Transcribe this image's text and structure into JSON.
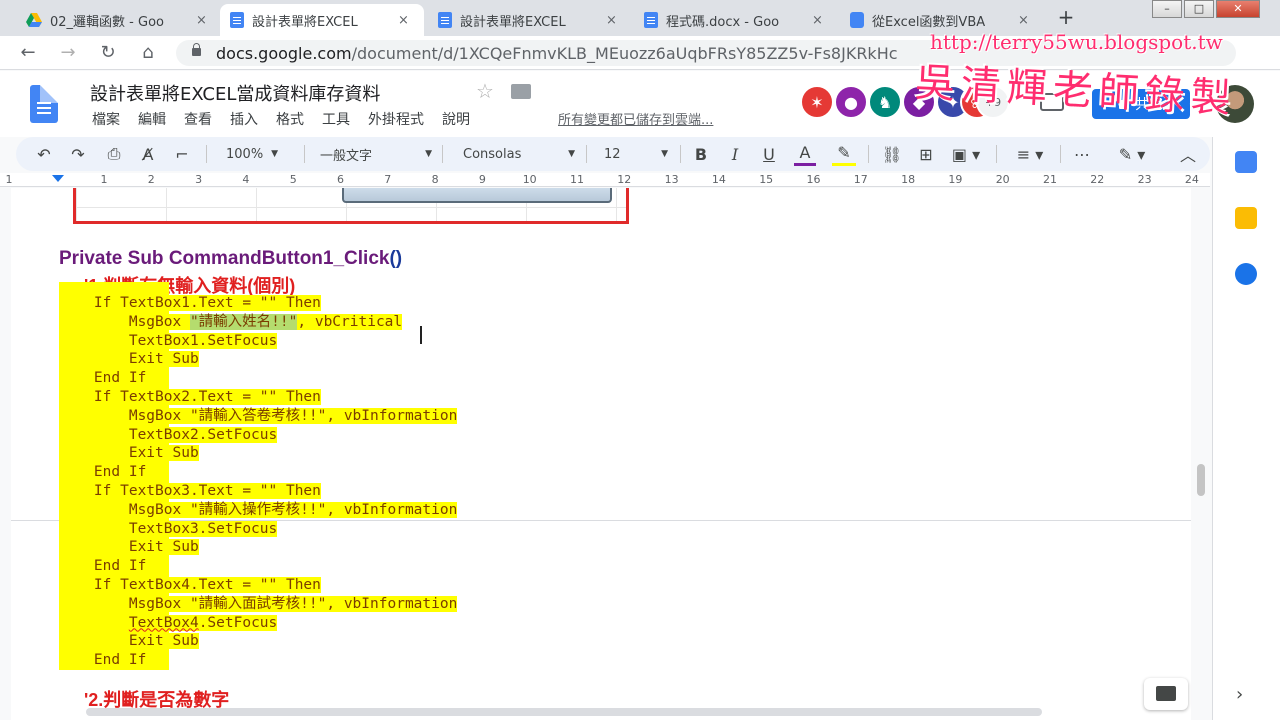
{
  "browser": {
    "tabs": [
      {
        "title": "02_邏輯函數 - Goo",
        "icon": "drive-icon"
      },
      {
        "title": "設計表單將EXCEL",
        "icon": "docs-icon"
      },
      {
        "title": "設計表單將EXCEL",
        "icon": "docs-icon"
      },
      {
        "title": "程式碼.docx - Goo",
        "icon": "docs-icon"
      },
      {
        "title": "從Excel函數到VBA",
        "icon": "chat-icon"
      }
    ],
    "tab_close": "×",
    "new_tab": "+",
    "url_host": "docs.google.com",
    "url_path": "/document/d/1XCQeFnmvKLB_MEuozz6aUqbFRsY85ZZ5v-Fs8JKRkHc",
    "watermark_url": "http://terry55wu.blogspot.tw",
    "watermark_text": "吳清輝老師錄製"
  },
  "docs": {
    "title": "設計表單將EXCEL當成資料庫存資料",
    "menus": [
      "檔案",
      "編輯",
      "查看",
      "插入",
      "格式",
      "工具",
      "外掛程式",
      "說明"
    ],
    "save_status": "所有變更都已儲存到雲端...",
    "share_label": "共用",
    "collaborator_more": "+9"
  },
  "toolbar": {
    "zoom": "100%",
    "style": "一般文字",
    "font": "Consolas",
    "size": "12",
    "bold": "B",
    "italic": "I",
    "underline": "U",
    "text_color": "A"
  },
  "ruler": [
    "1",
    "1",
    "2",
    "3",
    "4",
    "5",
    "6",
    "7",
    "8",
    "9",
    "10",
    "11",
    "12",
    "13",
    "14",
    "15",
    "16",
    "17",
    "18",
    "19",
    "20",
    "21",
    "22",
    "23",
    "24"
  ],
  "content": {
    "heading": "Private Sub CommandButton1_Click",
    "heading_parens": "()",
    "comment1": "'1.判斷有無輸入資料(個別)",
    "code_lines": [
      "    If TextBox1.Text = \"\" Then",
      "        MsgBox ",
      "        TextBox1.SetFocus",
      "        Exit Sub",
      "    End If",
      "    If TextBox2.Text = \"\" Then",
      "        MsgBox \"請輸入答卷考核!!\", vbInformation",
      "        TextBox2.SetFocus",
      "        Exit Sub",
      "    End If",
      "    If TextBox3.Text = \"\" Then",
      "        MsgBox \"請輸入操作考核!!\", vbInformation",
      "        TextBox3.SetFocus",
      "        Exit Sub",
      "    End If",
      "    If TextBox4.Text = \"\" Then",
      "        MsgBox \"請輸入面試考核!!\", vbInformation",
      "        ",
      "        Exit Sub",
      "    End If"
    ],
    "line2_selected": "\"請輸入姓名!!\"",
    "line2_rest": ", vbCritical",
    "line18_err": "TextBox4",
    "line18_rest": ".SetFocus",
    "comment2": "'2.判斷是否為數字"
  },
  "colors": {
    "highlight": "#ffff00",
    "selection": "#b5dc6e",
    "code_text": "#7a3d00",
    "heading": "#6a1b7a",
    "comment": "#e02020",
    "accent": "#1a73e8"
  }
}
